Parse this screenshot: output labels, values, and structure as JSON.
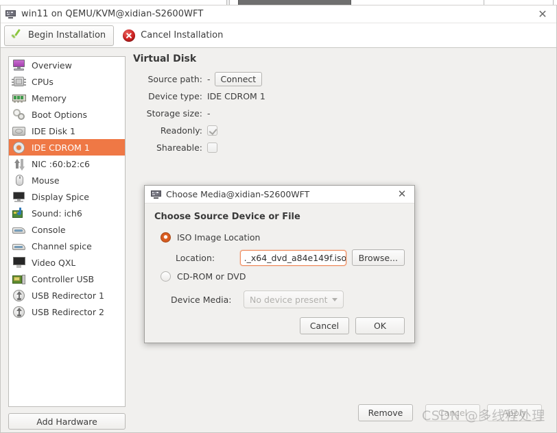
{
  "window": {
    "title": "win11 on QEMU/KVM@xidian-S2600WFT",
    "title_icon": "computer-icon",
    "close_label": "✕"
  },
  "toolbar": {
    "begin_label": "Begin Installation",
    "begin_icon": "green-check-icon",
    "cancel_label": "Cancel Installation",
    "cancel_icon": "red-x-circle-icon"
  },
  "sidebar": {
    "items": [
      {
        "label": "Overview",
        "icon": "monitor-icon",
        "key": "overview",
        "selected": false
      },
      {
        "label": "CPUs",
        "icon": "cpu-chip-icon",
        "key": "cpus",
        "selected": false
      },
      {
        "label": "Memory",
        "icon": "memory-stick-icon",
        "key": "memory",
        "selected": false
      },
      {
        "label": "Boot Options",
        "icon": "gears-icon",
        "key": "boot",
        "selected": false
      },
      {
        "label": "IDE Disk 1",
        "icon": "harddisk-icon",
        "key": "ide-disk-1",
        "selected": false
      },
      {
        "label": "IDE CDROM 1",
        "icon": "cdrom-disc-icon",
        "key": "ide-cdrom-1",
        "selected": true
      },
      {
        "label": "NIC :60:b2:c6",
        "icon": "network-arrows-icon",
        "key": "nic",
        "selected": false
      },
      {
        "label": "Mouse",
        "icon": "mouse-icon",
        "key": "mouse",
        "selected": false
      },
      {
        "label": "Display Spice",
        "icon": "display-icon",
        "key": "display",
        "selected": false
      },
      {
        "label": "Sound: ich6",
        "icon": "soundcard-icon",
        "key": "sound",
        "selected": false
      },
      {
        "label": "Console",
        "icon": "console-icon",
        "key": "console",
        "selected": false
      },
      {
        "label": "Channel spice",
        "icon": "console-icon",
        "key": "channel",
        "selected": false
      },
      {
        "label": "Video QXL",
        "icon": "video-icon",
        "key": "video",
        "selected": false
      },
      {
        "label": "Controller USB",
        "icon": "usb-controller-icon",
        "key": "controller",
        "selected": false
      },
      {
        "label": "USB Redirector 1",
        "icon": "usb-redirector-icon",
        "key": "usbredir-1",
        "selected": false
      },
      {
        "label": "USB Redirector 2",
        "icon": "usb-redirector-icon",
        "key": "usbredir-2",
        "selected": false
      }
    ],
    "add_hardware_label": "Add Hardware"
  },
  "detail": {
    "heading": "Virtual Disk",
    "fields": [
      {
        "label": "Source path:",
        "value": "-",
        "button": "Connect"
      },
      {
        "label": "Device type:",
        "value": "IDE CDROM 1",
        "button": null
      },
      {
        "label": "Storage size:",
        "value": "-",
        "button": null
      }
    ],
    "readonly_label": "Readonly:",
    "readonly_checked": true,
    "shareable_label": "Shareable:",
    "shareable_checked": false
  },
  "bottom": {
    "remove_label": "Remove",
    "cancel_label": "Cancel",
    "apply_label": "Apply"
  },
  "dialog": {
    "title": "Choose Media@xidian-S2600WFT",
    "title_icon": "computer-icon",
    "close_label": "✕",
    "heading": "Choose Source Device or File",
    "iso_radio_label": "ISO Image Location",
    "iso_radio_selected": true,
    "location_label": "Location:",
    "location_value_before_caret": "._x64_dvd_a84",
    "location_value_after_caret": "e149f.iso",
    "location_full_value": "._x64_dvd_a84e149f.iso",
    "browse_label": "Browse...",
    "cdrom_radio_label": "CD-ROM or DVD",
    "cdrom_radio_selected": false,
    "device_media_label": "Device Media:",
    "device_media_value": "No device present",
    "device_media_disabled": true,
    "cancel_label": "Cancel",
    "ok_label": "OK"
  },
  "watermark": {
    "text": "CSDN @多线程处理"
  },
  "colors": {
    "selection": "#ef7845",
    "radio_accent": "#c8541c",
    "field_border": "#ef8a5c",
    "window_bg": "#f1f0ee"
  }
}
